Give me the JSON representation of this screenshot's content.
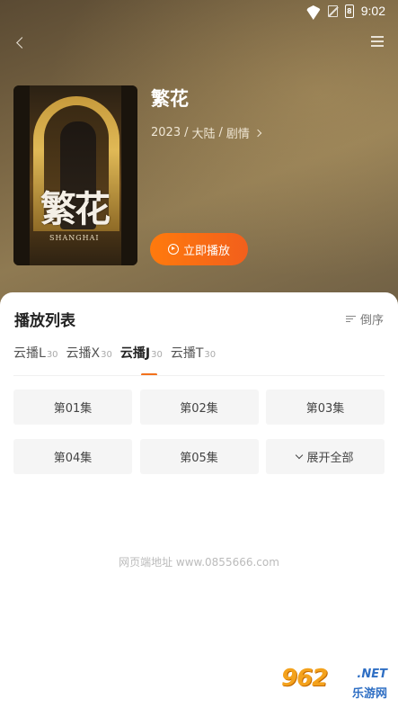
{
  "status_bar": {
    "time": "9:02",
    "battery_label": "8",
    "icons": [
      "wifi-icon",
      "sim-off-icon",
      "battery-charging-icon"
    ]
  },
  "header": {
    "back_icon": "chevron-left-icon",
    "menu_icon": "menu-icon"
  },
  "movie": {
    "title": "繁花",
    "year": "2023",
    "region": "大陆",
    "genre": "剧情",
    "separator": "/",
    "poster_title": "繁花",
    "poster_subtitle": "SHANGHAI"
  },
  "play_button": {
    "label": "立即播放",
    "icon": "play-circle-icon"
  },
  "playlist": {
    "title": "播放列表",
    "sort_label": "倒序",
    "sources": [
      {
        "name": "云播L",
        "count": "30",
        "active": false
      },
      {
        "name": "云播X",
        "count": "30",
        "active": false
      },
      {
        "name": "云播J",
        "count": "30",
        "active": true
      },
      {
        "name": "云播T",
        "count": "30",
        "active": false
      }
    ],
    "episodes": [
      "第01集",
      "第02集",
      "第03集",
      "第04集",
      "第05集"
    ],
    "expand_label": "展开全部"
  },
  "footer": {
    "text": "网页端地址 www.0855666.com"
  },
  "watermark": {
    "logo": "962",
    "net": ".NET",
    "name": "乐游网"
  },
  "colors": {
    "accent": "#f2711c",
    "button_gradient_start": "#ff7a0d",
    "button_gradient_end": "#f25f1c"
  }
}
